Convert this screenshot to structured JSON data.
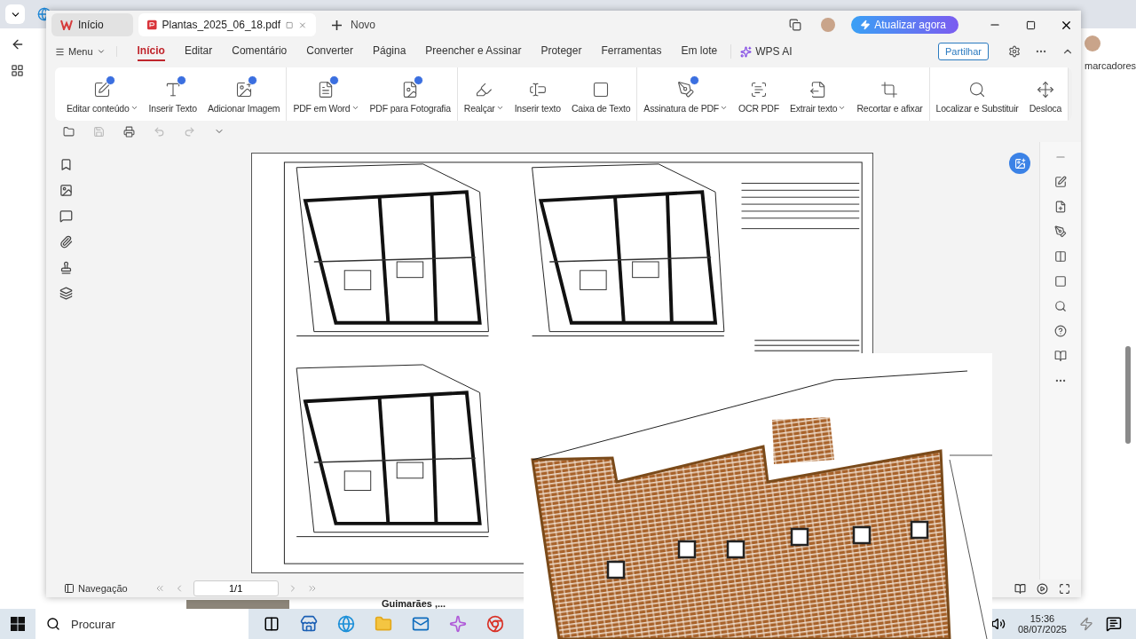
{
  "browser": {
    "bookmarks_text": "marcadores",
    "result_caption": "Guimarães ,..."
  },
  "wps": {
    "tabs": [
      {
        "label": "Início",
        "kind": "home",
        "selected": false
      },
      {
        "label": "Plantas_2025_06_18.pdf",
        "kind": "doc",
        "selected": true
      }
    ],
    "new_tab": "Novo",
    "upgrade_button": "Atualizar agora",
    "menu_button": "Menu",
    "ribbon_tabs": [
      {
        "label": "Início",
        "selected": true
      },
      {
        "label": "Editar",
        "selected": false
      },
      {
        "label": "Comentário",
        "selected": false
      },
      {
        "label": "Converter",
        "selected": false
      },
      {
        "label": "Página",
        "selected": false
      },
      {
        "label": "Preencher e Assinar",
        "selected": false
      },
      {
        "label": "Proteger",
        "selected": false
      },
      {
        "label": "Ferramentas",
        "selected": false
      },
      {
        "label": "Em lote",
        "selected": false
      }
    ],
    "ai_tab": "WPS AI",
    "share_button": "Partilhar",
    "tool_groups": [
      [
        {
          "label": "Editar conteúdo",
          "kind": "edit",
          "dropdown": true,
          "badge": true
        },
        {
          "label": "Inserir Texto",
          "kind": "text",
          "dropdown": false,
          "badge": true
        },
        {
          "label": "Adicionar Imagem",
          "kind": "image",
          "dropdown": false,
          "badge": true
        }
      ],
      [
        {
          "label": "PDF em Word",
          "kind": "word",
          "dropdown": true,
          "badge": true
        },
        {
          "label": "PDF para Fotografia",
          "kind": "photo",
          "dropdown": false,
          "badge": true
        }
      ],
      [
        {
          "label": "Realçar",
          "kind": "highlight",
          "dropdown": true,
          "badge": false
        },
        {
          "label": "Inserir texto",
          "kind": "textline",
          "dropdown": false,
          "badge": false
        },
        {
          "label": "Caixa de Texto",
          "kind": "textbox",
          "dropdown": false,
          "badge": false
        }
      ],
      [
        {
          "label": "Assinatura de PDF",
          "kind": "signature",
          "dropdown": true,
          "badge": true
        },
        {
          "label": "OCR PDF",
          "kind": "ocr",
          "dropdown": false,
          "badge": false
        },
        {
          "label": "Extrair texto",
          "kind": "extract",
          "dropdown": true,
          "badge": false
        },
        {
          "label": "Recortar e afixar",
          "kind": "crop",
          "dropdown": false,
          "badge": false
        }
      ],
      [
        {
          "label": "Localizar e Substituir",
          "kind": "search",
          "dropdown": false,
          "badge": false
        },
        {
          "label": "Desloca",
          "kind": "move",
          "dropdown": false,
          "badge": false
        }
      ]
    ],
    "status_bar": {
      "navigation": "Navegação",
      "page": "1/1"
    }
  },
  "taskbar": {
    "search_placeholder": "Procurar",
    "time": "15:36",
    "date": "08/07/2025"
  }
}
